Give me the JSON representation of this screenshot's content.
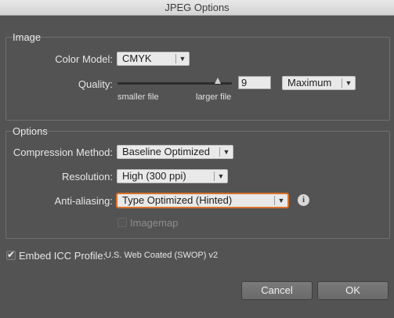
{
  "window": {
    "title": "JPEG Options"
  },
  "image_group": {
    "title": "Image",
    "color_model": {
      "label": "Color Model:",
      "value": "CMYK"
    },
    "quality": {
      "label": "Quality:",
      "value": "9",
      "slider_fraction": 0.9,
      "min_label": "smaller file",
      "max_label": "larger file",
      "preset": "Maximum"
    }
  },
  "options_group": {
    "title": "Options",
    "compression": {
      "label": "Compression Method:",
      "value": "Baseline Optimized"
    },
    "resolution": {
      "label": "Resolution:",
      "value": "High (300 ppi)"
    },
    "anti_aliasing": {
      "label": "Anti-aliasing:",
      "value": "Type Optimized (Hinted)"
    },
    "imagemap": {
      "label": "Imagemap",
      "checked": false,
      "enabled": false
    }
  },
  "embed_icc": {
    "label": "Embed ICC Profile:",
    "checked": true,
    "profile": "U.S. Web Coated (SWOP) v2"
  },
  "buttons": {
    "cancel": "Cancel",
    "ok": "OK"
  },
  "icons": {
    "dropdown": "chevron-down-icon",
    "info": "info-icon",
    "check": "checkmark-icon"
  },
  "colors": {
    "focus": "#d9722b",
    "background": "#535353"
  }
}
